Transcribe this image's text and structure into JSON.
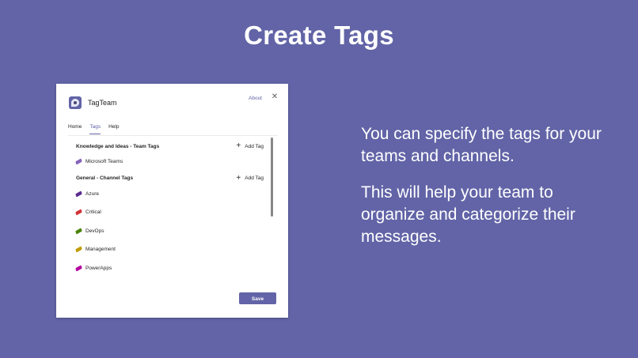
{
  "slide": {
    "title": "Create Tags",
    "paragraphs": [
      "You can specify the tags for your teams and channels.",
      "This will help your team to organize and categorize their messages."
    ]
  },
  "app": {
    "name": "TagTeam",
    "icon": "tagteam-logo-icon",
    "about_label": "About",
    "close_icon": "close-icon",
    "tabs": [
      {
        "label": "Home",
        "active": false
      },
      {
        "label": "Tags",
        "active": true
      },
      {
        "label": "Help",
        "active": false
      }
    ],
    "sections": [
      {
        "title": "Knowledge and Ideas - Team Tags",
        "add_label": "Add Tag",
        "tags": [
          {
            "label": "Microsoft Teams",
            "color": "#8764b8"
          }
        ]
      },
      {
        "title": "General - Channel Tags",
        "add_label": "Add Tag",
        "tags": [
          {
            "label": "Azure",
            "color": "#5c2e91"
          },
          {
            "label": "Critical",
            "color": "#d13438"
          },
          {
            "label": "DevOps",
            "color": "#498205"
          },
          {
            "label": "Management",
            "color": "#c19c00"
          },
          {
            "label": "PowerApps",
            "color": "#a4262c"
          }
        ]
      }
    ],
    "save_label": "Save"
  },
  "colors": {
    "background": "#6264a7",
    "accent": "#6264a7",
    "powerapps_tag": "#b4009e"
  }
}
